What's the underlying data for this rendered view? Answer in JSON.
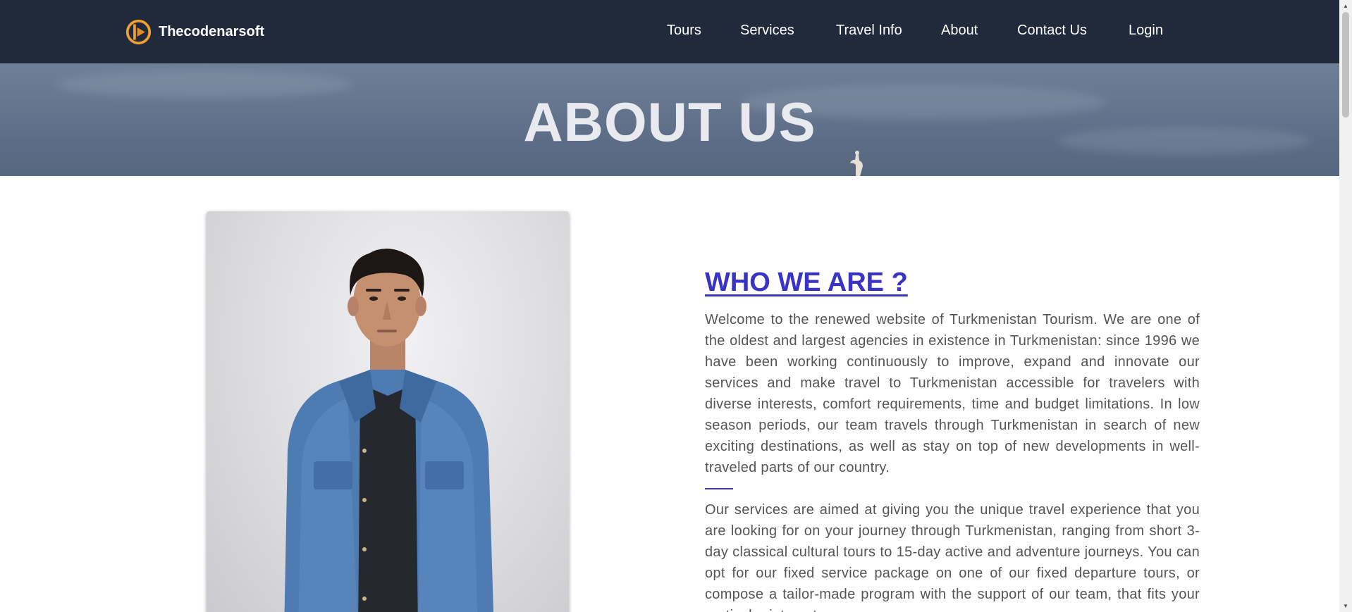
{
  "navbar": {
    "brand_name": "Thecodenarsoft",
    "links": [
      {
        "label": "Tours"
      },
      {
        "label": "Services"
      },
      {
        "label": "Travel Info"
      },
      {
        "label": "About"
      },
      {
        "label": "Contact Us"
      },
      {
        "label": "Login"
      }
    ]
  },
  "hero": {
    "title": "ABOUT US"
  },
  "about": {
    "heading": "WHO WE ARE ?",
    "paragraph1": "Welcome to the renewed website of Turkmenistan Tourism. We are one of the oldest and largest agencies in existence in Turkmenistan: since 1996 we have been working continuously to improve, expand and innovate our services and make travel to Turkmenistan accessible for travelers with diverse interests, comfort requirements, time and budget limitations. In low season periods, our team travels through Turkmenistan in search of new exciting destinations, as well as stay on top of new developments in well-traveled parts of our country.",
    "paragraph2": "Our services are aimed at giving you the unique travel experience that you are looking for on your journey through Turkmenistan, ranging from short 3-day classical cultural tours to 15-day active and adventure journeys. You can opt for our fixed service package on one of our fixed departure tours, or compose a tailor-made program with the support of our team, that fits your particular interests."
  },
  "colors": {
    "navbar_bg": "#212a3b",
    "heading_accent": "#3a34c4",
    "logo_orange": "#f0a030",
    "body_text": "#555555"
  },
  "icons": {
    "logo": "brand-logo-icon",
    "scroll_up": "triangle-up-icon",
    "scroll_down": "triangle-down-icon"
  }
}
